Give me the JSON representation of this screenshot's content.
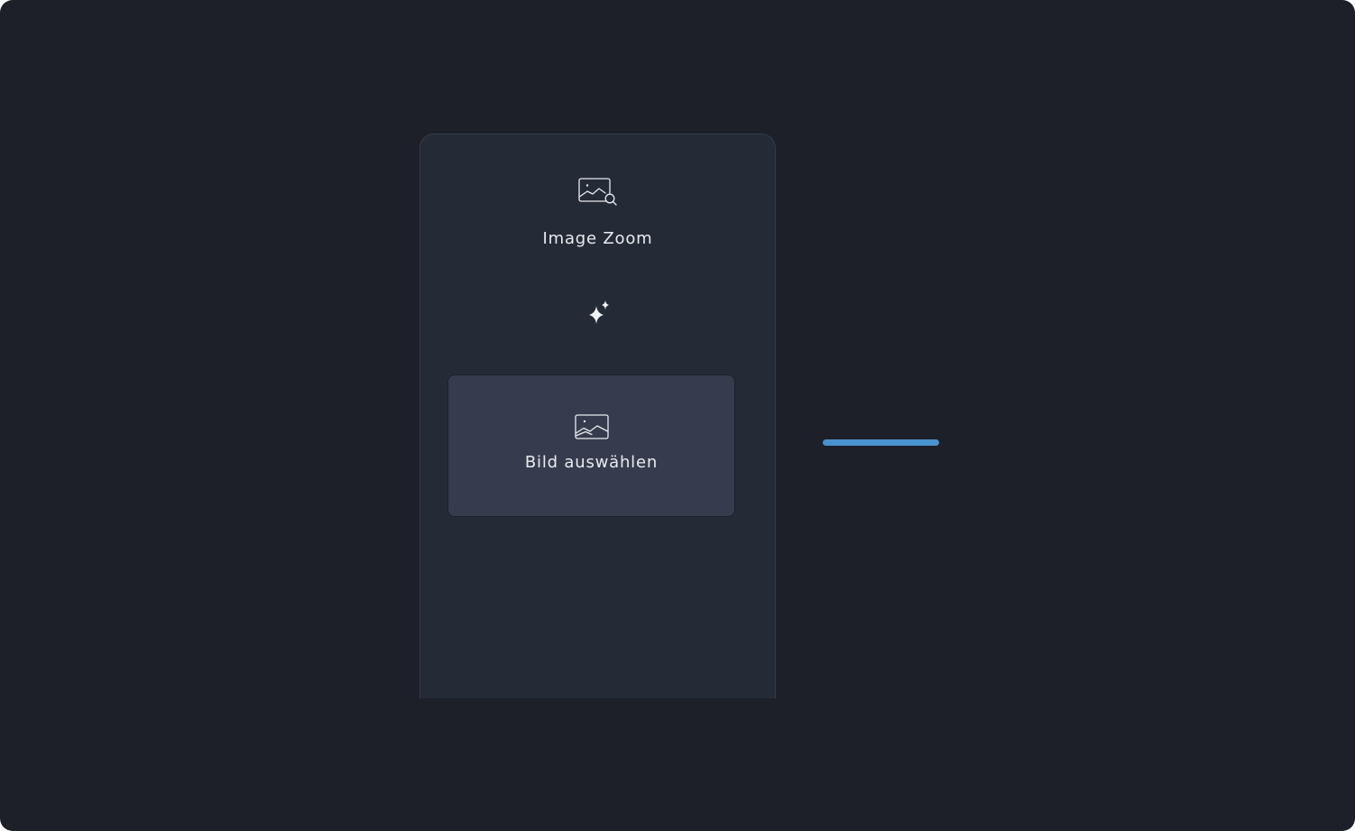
{
  "app": {
    "title": "Image Zoom",
    "icon": "image-zoom-icon"
  },
  "decoration": {
    "icon": "sparkle-icon"
  },
  "select_button": {
    "label": "Bild auswählen",
    "icon": "image-icon"
  },
  "loading": {
    "progress": 1.0
  },
  "colors": {
    "background": "#1d2029",
    "panel": "#252a37",
    "button": "#363c4d",
    "text": "#e9ebf0",
    "accent": "#4a93cf"
  }
}
